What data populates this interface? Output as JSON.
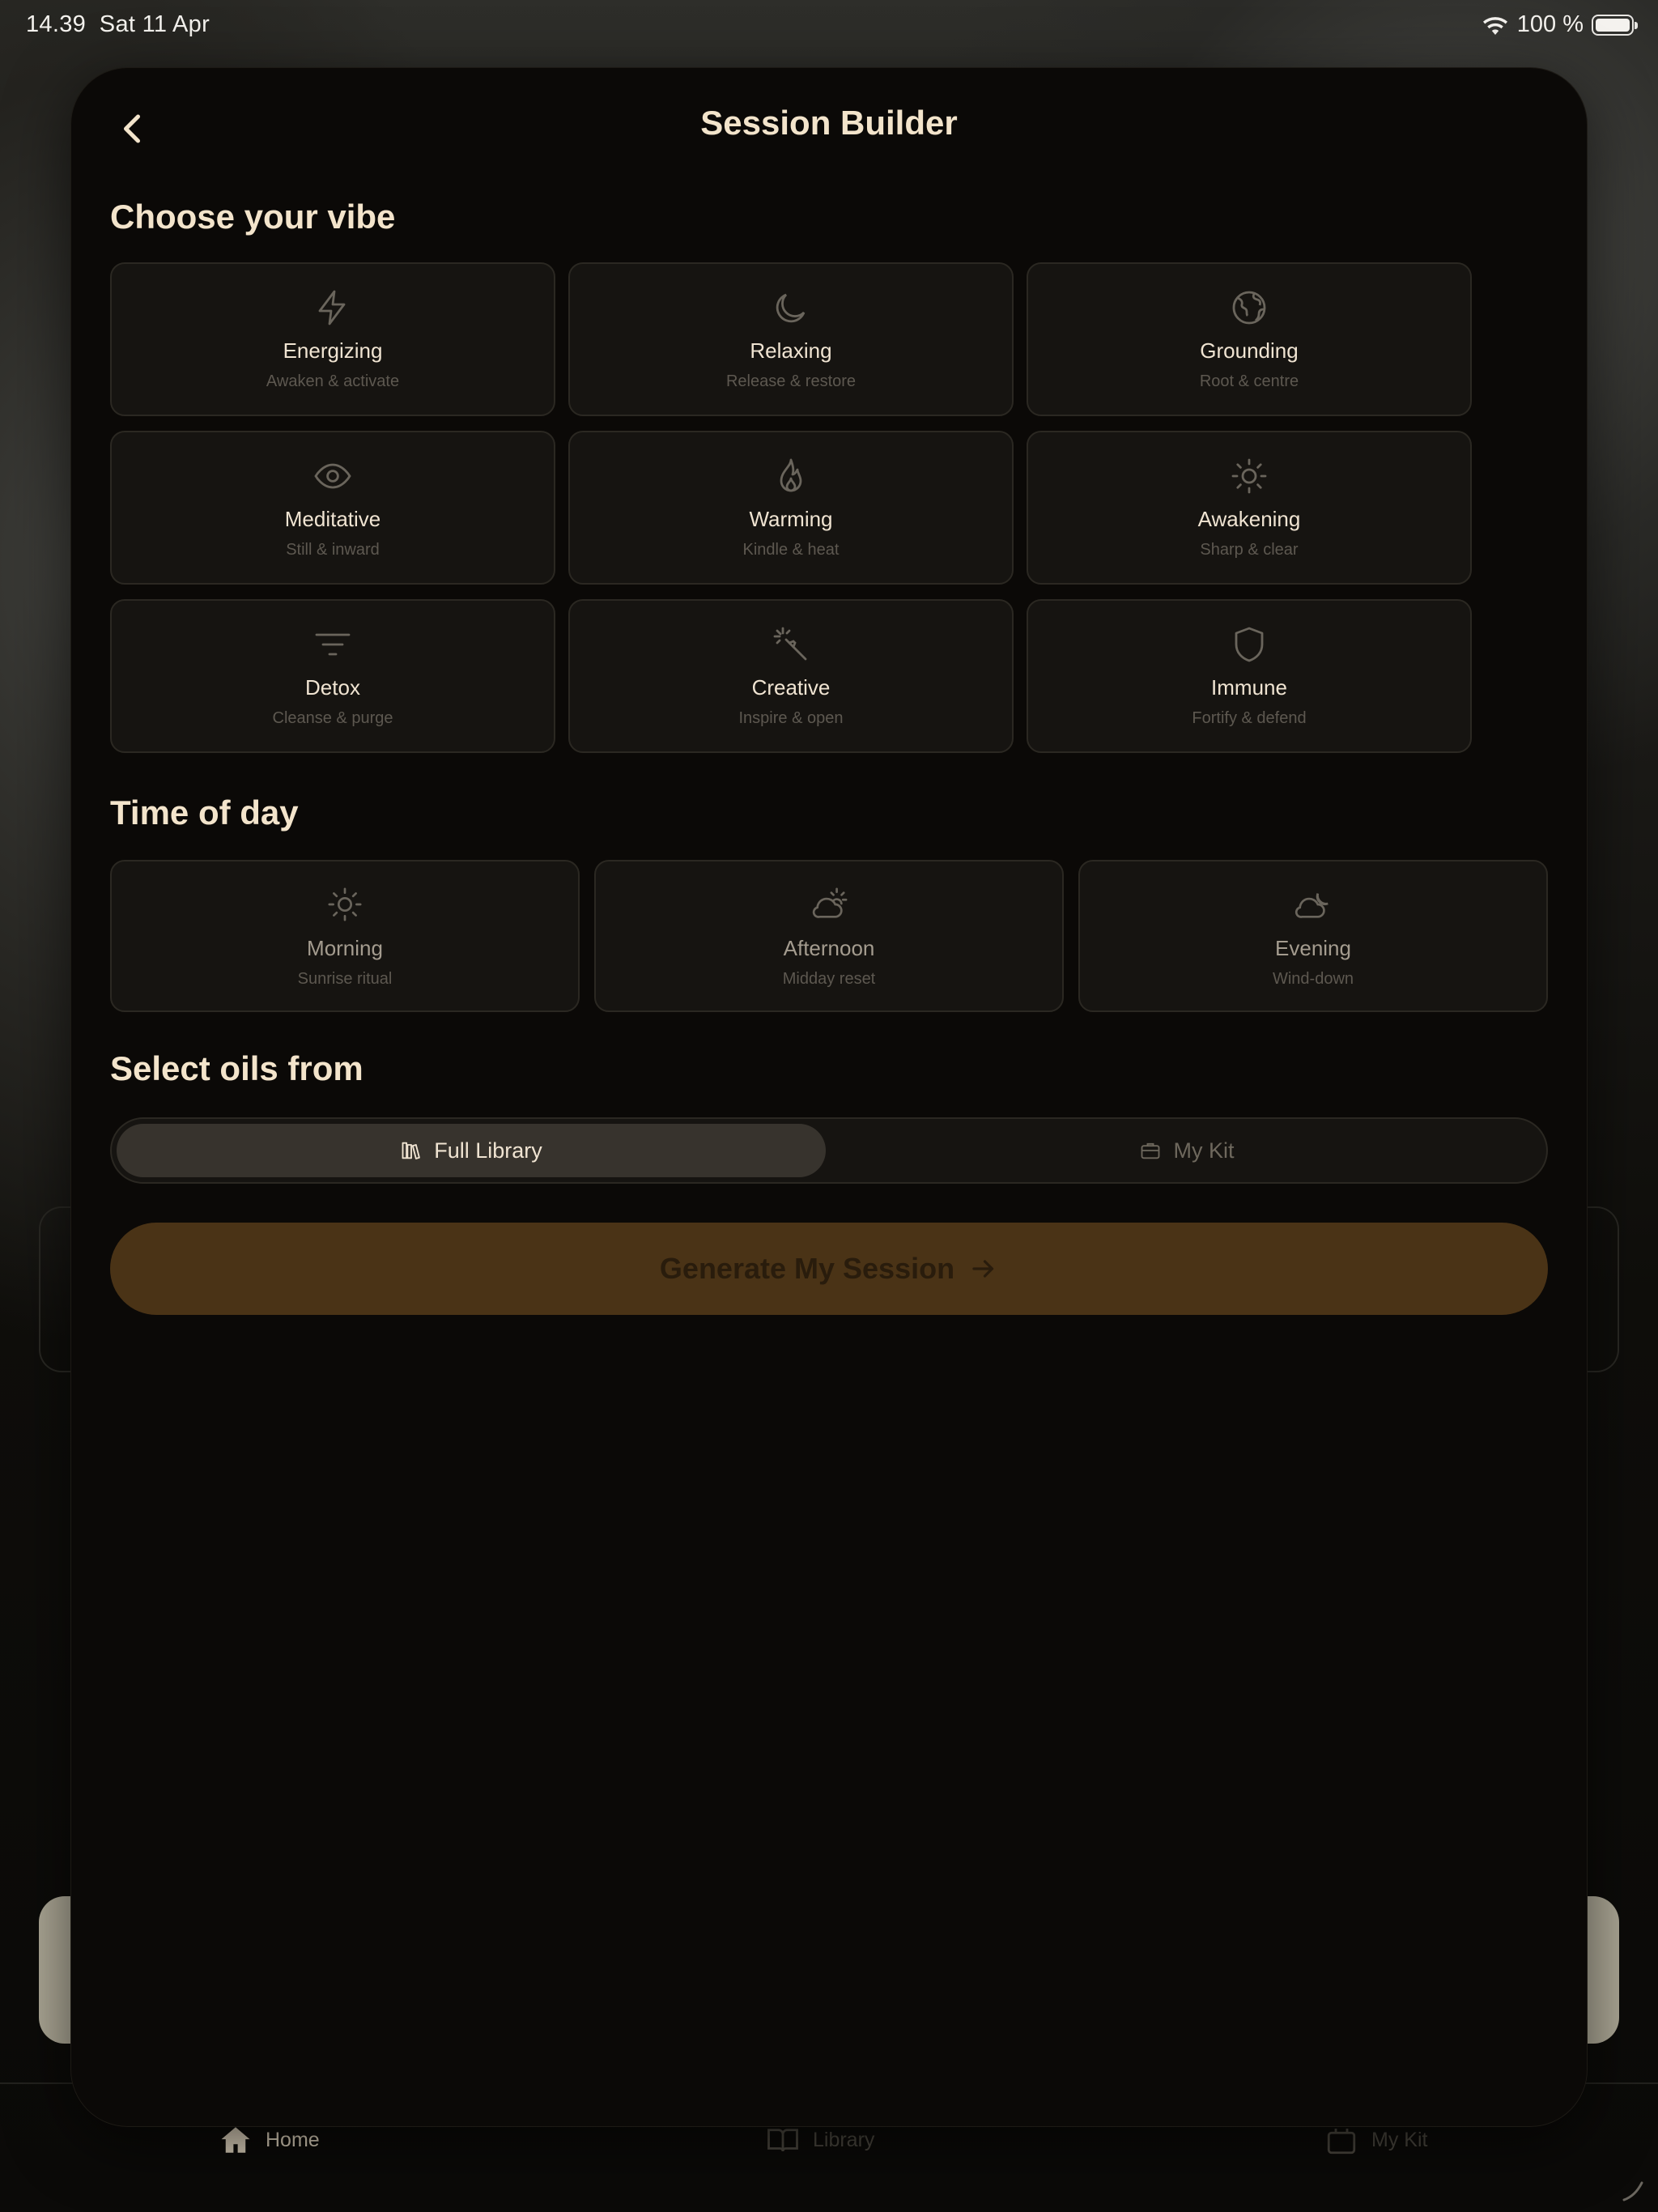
{
  "status_bar": {
    "time": "14.39",
    "date": "Sat 11 Apr",
    "battery": "100 %",
    "battery_level": 1.0
  },
  "sheet": {
    "title": "Session Builder",
    "vibe_section": {
      "title": "Choose your vibe",
      "options": [
        {
          "label": "Energizing",
          "sub": "Awaken & activate",
          "icon": "lightning-icon"
        },
        {
          "label": "Relaxing",
          "sub": "Release & restore",
          "icon": "moon-icon"
        },
        {
          "label": "Grounding",
          "sub": "Root & centre",
          "icon": "globe-icon"
        },
        {
          "label": "Meditative",
          "sub": "Still & inward",
          "icon": "eye-icon"
        },
        {
          "label": "Warming",
          "sub": "Kindle & heat",
          "icon": "flame-icon"
        },
        {
          "label": "Awakening",
          "sub": "Sharp & clear",
          "icon": "sun-icon"
        },
        {
          "label": "Detox",
          "sub": "Cleanse & purge",
          "icon": "filter-icon"
        },
        {
          "label": "Creative",
          "sub": "Inspire & open",
          "icon": "magic-wand-icon"
        },
        {
          "label": "Immune",
          "sub": "Fortify & defend",
          "icon": "shield-icon"
        }
      ]
    },
    "time_section": {
      "title": "Time of day",
      "options": [
        {
          "label": "Morning",
          "sub": "Sunrise ritual",
          "icon": "sun-icon"
        },
        {
          "label": "Afternoon",
          "sub": "Midday reset",
          "icon": "cloud-sun-icon"
        },
        {
          "label": "Evening",
          "sub": "Wind-down",
          "icon": "cloud-moon-icon"
        }
      ]
    },
    "source_section": {
      "title": "Select oils from",
      "options": [
        {
          "label": "Full Library",
          "icon": "library-icon",
          "selected": true
        },
        {
          "label": "My Kit",
          "icon": "briefcase-icon",
          "selected": false
        }
      ]
    },
    "generate_label": "Generate My Session"
  },
  "tab_bar": {
    "items": [
      {
        "label": "Home",
        "icon": "home-icon",
        "active": true
      },
      {
        "label": "Library",
        "icon": "book-icon",
        "active": false
      },
      {
        "label": "My Kit",
        "icon": "kit-icon",
        "active": false
      }
    ]
  },
  "colors": {
    "sheet_bg": "#0b0907",
    "card_bg": "#161411",
    "card_border": "#2b2822",
    "heading": "#f3e4cb",
    "accent_button": "#4a3316",
    "icon_muted": "#6a655c"
  }
}
